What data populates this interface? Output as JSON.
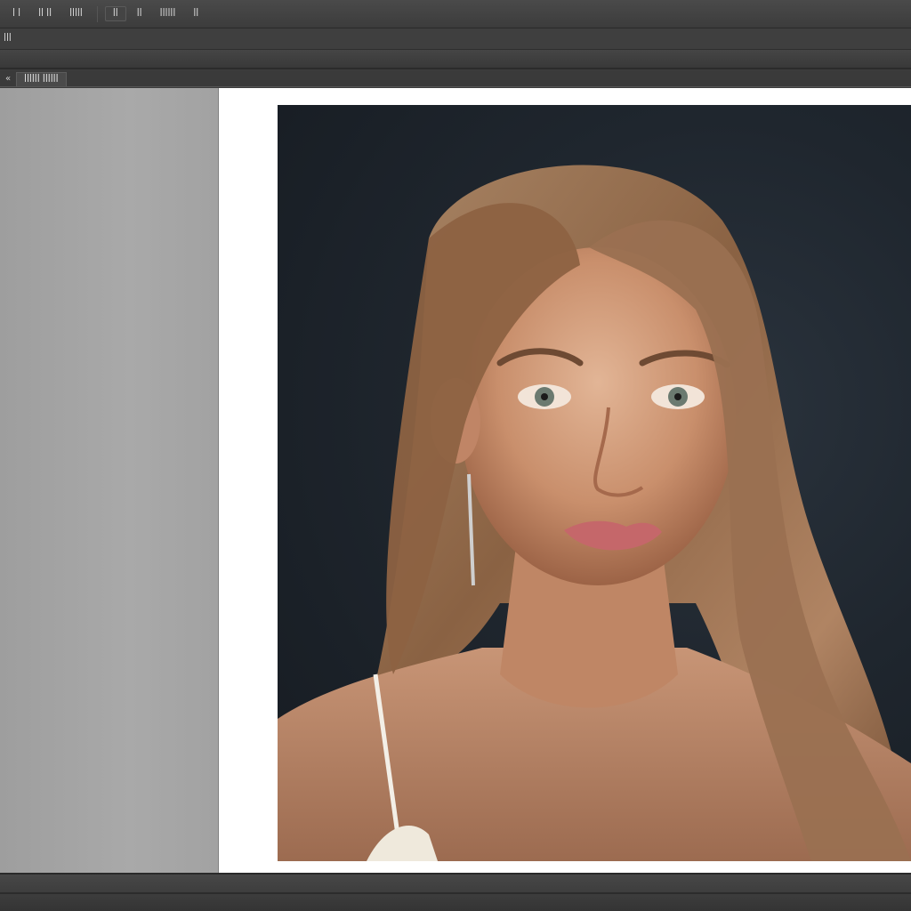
{
  "menubar": {
    "items": [
      "ꟾ ꟾ",
      "ꟾꟾ ꟾꟾ",
      "ꟾꟾꟾꟾꟾ",
      "ꟾꟾ",
      "ꟾꟾ",
      "ꟾꟾꟾꟾꟾꟾ",
      "ꟾꟾ"
    ]
  },
  "optionsbar": {
    "label": "ꟾꟾꟾ"
  },
  "tabbar": {
    "arrow": "«",
    "doc_tab": "ꟾꟾꟾꟾꟾꟾ ꟾꟾꟾꟾꟾꟾ"
  },
  "colors": {
    "chrome_dark": "#3b3b3b",
    "canvas_white": "#ffffff",
    "panel_gray": "#a4a4a4",
    "photo_bg": "#1f262e"
  }
}
